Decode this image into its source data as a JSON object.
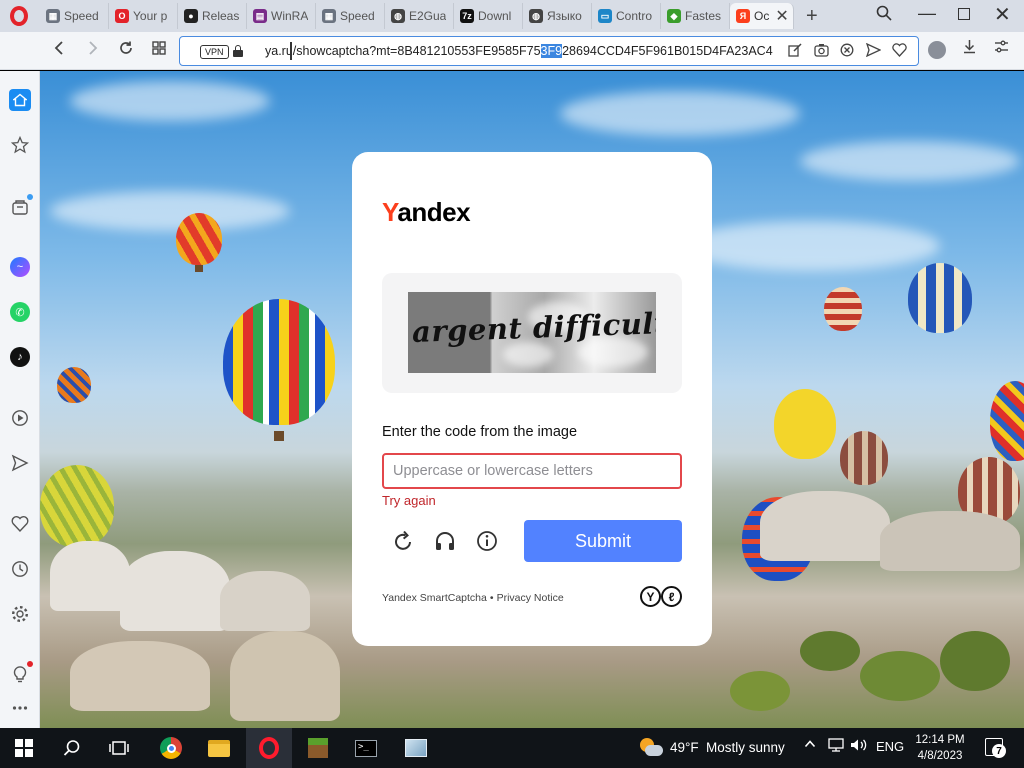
{
  "browser": {
    "tabs": [
      {
        "label": "Speed",
        "favicon": "grid-icon",
        "color": "#6b7380"
      },
      {
        "label": "Your p",
        "favicon": "opera-icon",
        "color": "#e3232a"
      },
      {
        "label": "Releas",
        "favicon": "github-icon",
        "color": "#222222"
      },
      {
        "label": "WinRA",
        "favicon": "winrar-icon",
        "color": "#7a2c8a"
      },
      {
        "label": "Speed",
        "favicon": "grid-icon",
        "color": "#6b7380"
      },
      {
        "label": "E2Gua",
        "favicon": "globe-icon",
        "color": "#444444"
      },
      {
        "label": "Downl",
        "favicon": "7zip-icon",
        "color": "#111111"
      },
      {
        "label": "Языко",
        "favicon": "globe-icon",
        "color": "#444444"
      },
      {
        "label": "Contro",
        "favicon": "monitor-icon",
        "color": "#1d86c8"
      },
      {
        "label": "Fastes",
        "favicon": "bluestacks-icon",
        "color": "#3a9d2c"
      },
      {
        "label": "Oc",
        "favicon": "yandex-icon",
        "color": "#fc3f1d"
      }
    ],
    "url": {
      "before": "ya.ru/showcaptcha?mt=8B481210553FE9585F75",
      "selected": "3F9",
      "after": "28694CCD4F5F961B015D4FA23AC4"
    },
    "vpn_label": "VPN"
  },
  "captcha": {
    "logo_first": "Y",
    "logo_rest": "andex",
    "image_text": "argent difficultly",
    "prompt": "Enter the code from the image",
    "input_placeholder": "Uppercase or lowercase letters",
    "input_value": "",
    "error": "Try again",
    "submit_label": "Submit",
    "footer_brand": "Yandex SmartCaptcha",
    "footer_separator": "•",
    "footer_privacy": "Privacy Notice",
    "accent_color": "#5282ff",
    "error_color": "#e3474b"
  },
  "taskbar": {
    "weather_temp": "49°F",
    "weather_condition": "Mostly sunny",
    "language": "ENG",
    "time": "12:14 PM",
    "date": "4/8/2023",
    "notification_count": "7"
  }
}
